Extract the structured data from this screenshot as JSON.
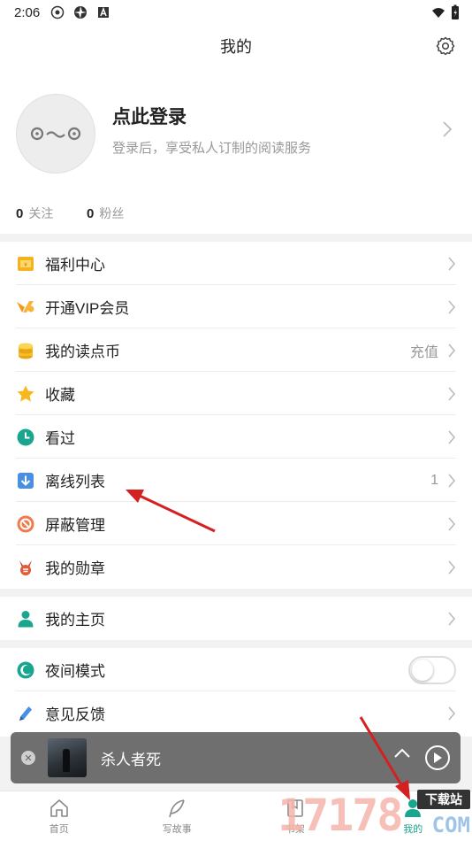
{
  "status_bar": {
    "time": "2:06"
  },
  "header": {
    "title": "我的"
  },
  "profile": {
    "title": "点此登录",
    "subtitle": "登录后，享受私人订制的阅读服务",
    "following_count": "0",
    "following_label": "关注",
    "fans_count": "0",
    "fans_label": "粉丝"
  },
  "menu_group_1": [
    {
      "label": "福利中心",
      "icon": "gift-icon",
      "value": ""
    },
    {
      "label": "开通VIP会员",
      "icon": "vip-icon",
      "value": ""
    },
    {
      "label": "我的读点币",
      "icon": "coin-icon",
      "value": "充值"
    },
    {
      "label": "收藏",
      "icon": "star-icon",
      "value": ""
    },
    {
      "label": "看过",
      "icon": "clock-icon",
      "value": ""
    },
    {
      "label": "离线列表",
      "icon": "download-icon",
      "value": "1"
    },
    {
      "label": "屏蔽管理",
      "icon": "block-icon",
      "value": ""
    },
    {
      "label": "我的勋章",
      "icon": "medal-icon",
      "value": ""
    }
  ],
  "menu_group_2": [
    {
      "label": "我的主页",
      "icon": "person-icon"
    }
  ],
  "menu_group_3": [
    {
      "label": "夜间模式",
      "icon": "moon-icon",
      "night_mode_on": false
    },
    {
      "label": "意见反馈",
      "icon": "pen-icon"
    }
  ],
  "player": {
    "title": "杀人者死"
  },
  "tabbar": [
    {
      "label": "首页",
      "icon": "home-icon",
      "active": false
    },
    {
      "label": "写故事",
      "icon": "feather-icon",
      "active": false
    },
    {
      "label": "书架",
      "icon": "bookshelf-icon",
      "active": false
    },
    {
      "label": "我的",
      "icon": "profile-icon",
      "active": true
    }
  ],
  "watermark": {
    "digits": "17178",
    "badge": "下载站",
    "suffix": "COM"
  },
  "colors": {
    "accent": "#1aa58e",
    "annotation_arrow": "#d42020"
  }
}
